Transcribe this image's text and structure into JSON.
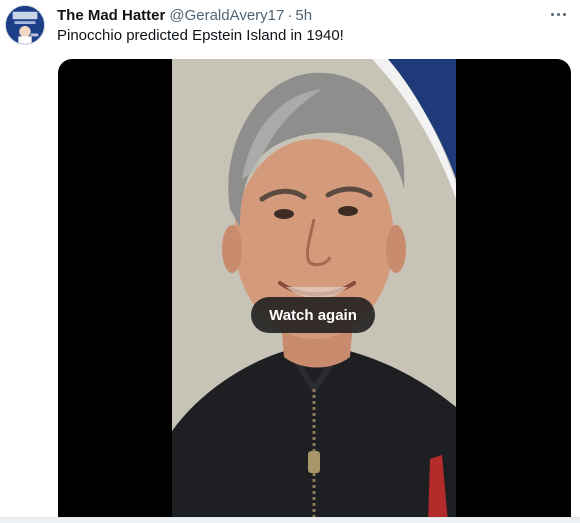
{
  "tweet": {
    "display_name": "The Mad Hatter",
    "handle": "@GeraldAvery17",
    "separator": "·",
    "time": "5h",
    "text": "Pinocchio predicted Epstein Island in 1940!"
  },
  "media": {
    "type": "video",
    "overlay_button_label": "Watch again"
  },
  "icons": {
    "more": "more-horizontal-icon",
    "avatar": "user-avatar"
  },
  "colors": {
    "text_primary": "#0f1419",
    "text_secondary": "#536471",
    "media_background": "#000000"
  }
}
